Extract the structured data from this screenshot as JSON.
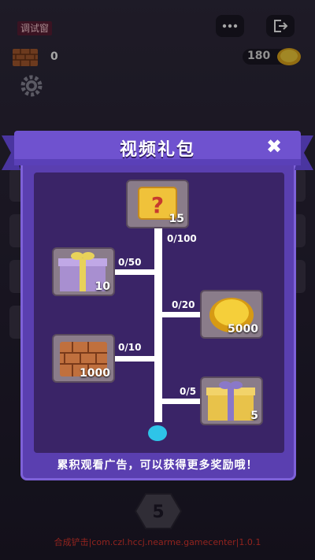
{
  "debug_label": "调试窗",
  "top_bar": {
    "brick_count": "0",
    "coin_count": "180"
  },
  "footer": "合成铲击|com.czl.hccj.nearme.gamecenter|1.0.1",
  "background_level": "5",
  "modal": {
    "title": "视频礼包",
    "close_label": "✖",
    "hint": "累积观看广告，可以获得更多奖励哦！",
    "rewards": [
      {
        "item": "mystery-box",
        "count": "15",
        "progress": "0/100"
      },
      {
        "item": "gift-box",
        "count": "10",
        "progress": "0/50"
      },
      {
        "item": "gold-coin",
        "count": "5000",
        "progress": "0/20"
      },
      {
        "item": "bricks",
        "count": "1000",
        "progress": "0/10"
      },
      {
        "item": "gift-box",
        "count": "5",
        "progress": "0/5"
      }
    ]
  },
  "colors": {
    "modal_frame": "#5a3fb0",
    "modal_inner": "#3a2467",
    "start_node": "#2ec4e8",
    "footer_text": "#e0362e"
  }
}
